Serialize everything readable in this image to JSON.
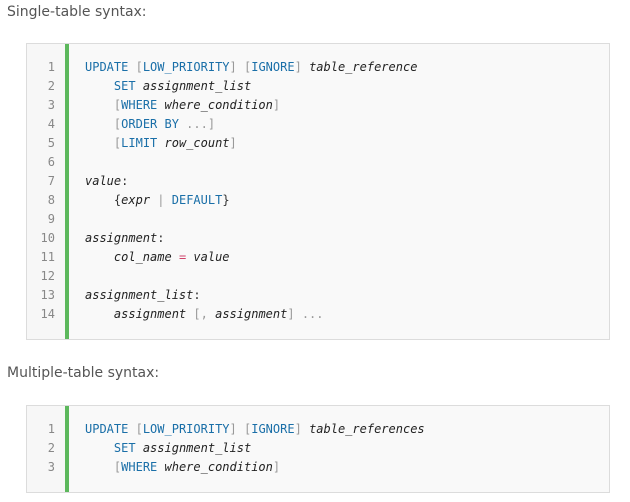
{
  "sections": [
    {
      "label": "Single-table syntax:",
      "lines": [
        {
          "n": "1",
          "indent": "",
          "tokens": [
            {
              "t": "UPDATE",
              "k": "kw"
            },
            {
              "t": " ",
              "k": "pl"
            },
            {
              "t": "[",
              "k": "br"
            },
            {
              "t": "LOW_PRIORITY",
              "k": "kw"
            },
            {
              "t": "]",
              "k": "br"
            },
            {
              "t": " ",
              "k": "pl"
            },
            {
              "t": "[",
              "k": "br"
            },
            {
              "t": "IGNORE",
              "k": "kw"
            },
            {
              "t": "]",
              "k": "br"
            },
            {
              "t": " ",
              "k": "pl"
            },
            {
              "t": "table_reference",
              "k": "id"
            }
          ]
        },
        {
          "n": "2",
          "indent": "    ",
          "tokens": [
            {
              "t": "SET",
              "k": "kw"
            },
            {
              "t": " ",
              "k": "pl"
            },
            {
              "t": "assignment_list",
              "k": "id"
            }
          ]
        },
        {
          "n": "3",
          "indent": "    ",
          "tokens": [
            {
              "t": "[",
              "k": "br"
            },
            {
              "t": "WHERE",
              "k": "kw"
            },
            {
              "t": " ",
              "k": "pl"
            },
            {
              "t": "where_condition",
              "k": "id"
            },
            {
              "t": "]",
              "k": "br"
            }
          ]
        },
        {
          "n": "4",
          "indent": "    ",
          "tokens": [
            {
              "t": "[",
              "k": "br"
            },
            {
              "t": "ORDER BY",
              "k": "kw"
            },
            {
              "t": " ",
              "k": "pl"
            },
            {
              "t": "...",
              "k": "br"
            },
            {
              "t": "]",
              "k": "br"
            }
          ]
        },
        {
          "n": "5",
          "indent": "    ",
          "tokens": [
            {
              "t": "[",
              "k": "br"
            },
            {
              "t": "LIMIT",
              "k": "kw"
            },
            {
              "t": " ",
              "k": "pl"
            },
            {
              "t": "row_count",
              "k": "id"
            },
            {
              "t": "]",
              "k": "br"
            }
          ]
        },
        {
          "n": "6",
          "indent": "",
          "tokens": []
        },
        {
          "n": "7",
          "indent": "",
          "tokens": [
            {
              "t": "value",
              "k": "id"
            },
            {
              "t": ":",
              "k": "pl"
            }
          ]
        },
        {
          "n": "8",
          "indent": "    ",
          "tokens": [
            {
              "t": "{",
              "k": "pl"
            },
            {
              "t": "expr",
              "k": "id"
            },
            {
              "t": " ",
              "k": "pl"
            },
            {
              "t": "|",
              "k": "br"
            },
            {
              "t": " ",
              "k": "pl"
            },
            {
              "t": "DEFAULT",
              "k": "kw"
            },
            {
              "t": "}",
              "k": "pl"
            }
          ]
        },
        {
          "n": "9",
          "indent": "",
          "tokens": []
        },
        {
          "n": "10",
          "indent": "",
          "tokens": [
            {
              "t": "assignment",
              "k": "id"
            },
            {
              "t": ":",
              "k": "pl"
            }
          ]
        },
        {
          "n": "11",
          "indent": "    ",
          "tokens": [
            {
              "t": "col_name",
              "k": "id"
            },
            {
              "t": " ",
              "k": "pl"
            },
            {
              "t": "=",
              "k": "op"
            },
            {
              "t": " ",
              "k": "pl"
            },
            {
              "t": "value",
              "k": "id"
            }
          ]
        },
        {
          "n": "12",
          "indent": "",
          "tokens": []
        },
        {
          "n": "13",
          "indent": "",
          "tokens": [
            {
              "t": "assignment_list",
              "k": "id"
            },
            {
              "t": ":",
              "k": "pl"
            }
          ]
        },
        {
          "n": "14",
          "indent": "    ",
          "tokens": [
            {
              "t": "assignment",
              "k": "id"
            },
            {
              "t": " ",
              "k": "pl"
            },
            {
              "t": "[",
              "k": "br"
            },
            {
              "t": ",",
              "k": "br"
            },
            {
              "t": " ",
              "k": "pl"
            },
            {
              "t": "assignment",
              "k": "id"
            },
            {
              "t": "]",
              "k": "br"
            },
            {
              "t": " ",
              "k": "pl"
            },
            {
              "t": "...",
              "k": "br"
            }
          ]
        }
      ]
    },
    {
      "label": "Multiple-table syntax:",
      "lines": [
        {
          "n": "1",
          "indent": "",
          "tokens": [
            {
              "t": "UPDATE",
              "k": "kw"
            },
            {
              "t": " ",
              "k": "pl"
            },
            {
              "t": "[",
              "k": "br"
            },
            {
              "t": "LOW_PRIORITY",
              "k": "kw"
            },
            {
              "t": "]",
              "k": "br"
            },
            {
              "t": " ",
              "k": "pl"
            },
            {
              "t": "[",
              "k": "br"
            },
            {
              "t": "IGNORE",
              "k": "kw"
            },
            {
              "t": "]",
              "k": "br"
            },
            {
              "t": " ",
              "k": "pl"
            },
            {
              "t": "table_references",
              "k": "id"
            }
          ]
        },
        {
          "n": "2",
          "indent": "    ",
          "tokens": [
            {
              "t": "SET",
              "k": "kw"
            },
            {
              "t": " ",
              "k": "pl"
            },
            {
              "t": "assignment_list",
              "k": "id"
            }
          ]
        },
        {
          "n": "3",
          "indent": "    ",
          "tokens": [
            {
              "t": "[",
              "k": "br"
            },
            {
              "t": "WHERE",
              "k": "kw"
            },
            {
              "t": " ",
              "k": "pl"
            },
            {
              "t": "where_condition",
              "k": "id"
            },
            {
              "t": "]",
              "k": "br"
            }
          ]
        }
      ]
    }
  ]
}
